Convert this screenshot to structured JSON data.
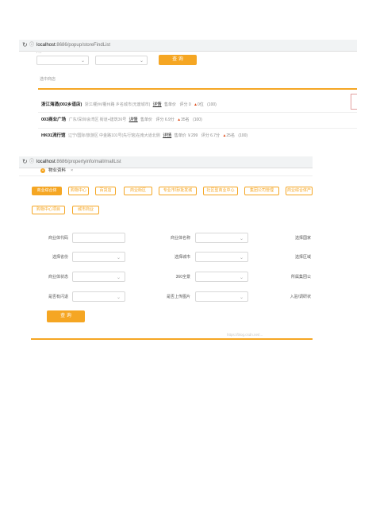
{
  "shot1": {
    "url_host": "localhost",
    "url_path": ":8686/popup/storeFindList",
    "cut_text": "...",
    "query_label": "查 询",
    "selected_label": "选中商店",
    "malls": [
      {
        "name": "浙江海涌(002乡道店)",
        "addr": "浙江/衢州/衢州路  乡名城市(无废城市)",
        "detail": "详情",
        "price": "售单价",
        "score": "评分 0",
        "fire": "0位",
        "count": "(100)"
      },
      {
        "name": "003商业广场",
        "addr": "广东/深圳/会湾区  街道+建筑36号",
        "detail": "详情",
        "price": "售单价",
        "score": "评分 6.9分",
        "fire": "35名",
        "count": "(100)"
      },
      {
        "name": "HK01流行馆",
        "addr": "辽宁/国际/旅游区  中金路101号(先行馆)在南大道北侧",
        "detail": "详情",
        "price": "售单价 ￥299",
        "score": "评分 6.7分",
        "fire": "25名",
        "count": "(100)"
      }
    ]
  },
  "shot2": {
    "url_host": "localhost",
    "url_path": ":8686/propertyinfo/mall/mallList",
    "tab_label": "物业资料",
    "tab_close": "×",
    "categories": [
      "商业综合体",
      "购物中心",
      "百货店",
      "商业街区",
      "专业市场/批发城",
      "社区型商业中心",
      "集团公司管理",
      "商业综合体产",
      "购物中心项目",
      "城市商业"
    ],
    "fields": [
      {
        "label": "商业体代码",
        "type": "input"
      },
      {
        "label": "商业体名称",
        "type": "select"
      },
      {
        "label": "选择国家",
        "type": "partial"
      },
      {
        "label": "选择省份",
        "type": "select"
      },
      {
        "label": "选择城市",
        "type": "select"
      },
      {
        "label": "选择区域",
        "type": "partial"
      },
      {
        "label": "商业体状态",
        "type": "select"
      },
      {
        "label": "360全景",
        "type": "select"
      },
      {
        "label": "所属集团公",
        "type": "partial"
      },
      {
        "label": "是否有闪退",
        "type": "select"
      },
      {
        "label": "是否上传图片",
        "type": "select"
      },
      {
        "label": "入驻/调研状",
        "type": "partial"
      }
    ],
    "query_label": "查 询",
    "watermark": "https://blog.csdn.net/..."
  }
}
